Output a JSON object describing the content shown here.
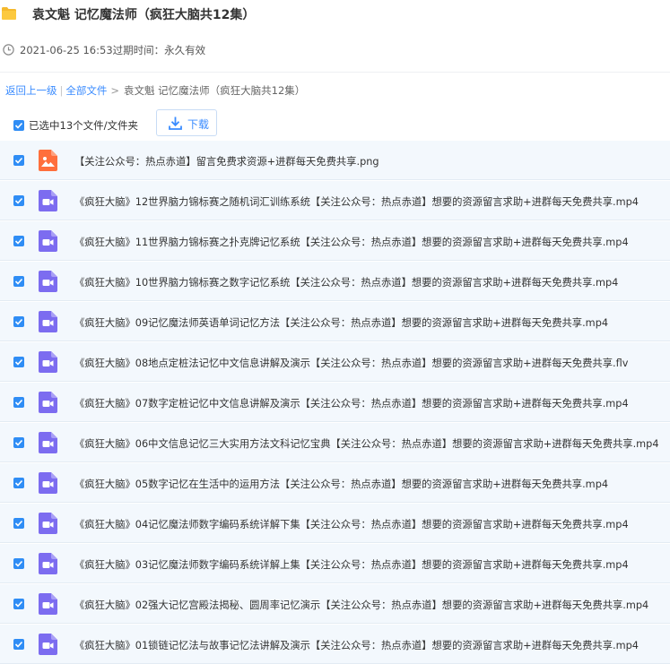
{
  "header": {
    "title": "袁文魁 记忆魔法师（疯狂大脑共12集）",
    "meta": "2021-06-25 16:53过期时间：永久有效"
  },
  "breadcrumb": {
    "back": "返回上一级",
    "all_files": "全部文件",
    "current": "袁文魁 记忆魔法师（疯狂大脑共12集）"
  },
  "toolbar": {
    "selected_text": "已选中13个文件/文件夹",
    "download_label": "下载"
  },
  "files": [
    {
      "type": "image",
      "name": "【关注公众号：热点赤道】留言免费求资源+进群每天免费共享.png"
    },
    {
      "type": "video",
      "name": "《疯狂大脑》12世界脑力锦标赛之随机词汇训练系统【关注公众号：热点赤道】想要的资源留言求助+进群每天免费共享.mp4"
    },
    {
      "type": "video",
      "name": "《疯狂大脑》11世界脑力锦标赛之扑克牌记忆系统【关注公众号：热点赤道】想要的资源留言求助+进群每天免费共享.mp4"
    },
    {
      "type": "video",
      "name": "《疯狂大脑》10世界脑力锦标赛之数字记忆系统【关注公众号：热点赤道】想要的资源留言求助+进群每天免费共享.mp4"
    },
    {
      "type": "video",
      "name": "《疯狂大脑》09记忆魔法师英语单词记忆方法【关注公众号：热点赤道】想要的资源留言求助+进群每天免费共享.mp4"
    },
    {
      "type": "video",
      "name": "《疯狂大脑》08地点定桩法记忆中文信息讲解及演示【关注公众号：热点赤道】想要的资源留言求助+进群每天免费共享.flv"
    },
    {
      "type": "video",
      "name": "《疯狂大脑》07数字定桩记忆中文信息讲解及演示【关注公众号：热点赤道】想要的资源留言求助+进群每天免费共享.mp4"
    },
    {
      "type": "video",
      "name": "《疯狂大脑》06中文信息记忆三大实用方法文科记忆宝典【关注公众号：热点赤道】想要的资源留言求助+进群每天免费共享.mp4"
    },
    {
      "type": "video",
      "name": "《疯狂大脑》05数字记忆在生活中的运用方法【关注公众号：热点赤道】想要的资源留言求助+进群每天免费共享.mp4"
    },
    {
      "type": "video",
      "name": "《疯狂大脑》04记忆魔法师数字编码系统详解下集【关注公众号：热点赤道】想要的资源留言求助+进群每天免费共享.mp4"
    },
    {
      "type": "video",
      "name": "《疯狂大脑》03记忆魔法师数字编码系统详解上集【关注公众号：热点赤道】想要的资源留言求助+进群每天免费共享.mp4"
    },
    {
      "type": "video",
      "name": "《疯狂大脑》02强大记忆宫殿法揭秘、圆周率记忆演示【关注公众号：热点赤道】想要的资源留言求助+进群每天免费共享.mp4"
    },
    {
      "type": "video",
      "name": "《疯狂大脑》01锁链记忆法与故事记忆法讲解及演示【关注公众号：热点赤道】想要的资源留言求助+进群每天免费共享.mp4"
    }
  ],
  "colors": {
    "accent": "#2f8df5",
    "link": "#3b8cff",
    "row_bg": "#f3f8fd",
    "video_icon": "#7c6cf0",
    "image_icon": "#ff6f3c",
    "folder_icon": "#f5b92d"
  },
  "icons": {
    "folder": "folder-icon",
    "clock": "clock-icon",
    "download": "download-icon",
    "video": "video-file-icon",
    "image": "image-file-icon",
    "check": "checkbox-checked-icon"
  }
}
